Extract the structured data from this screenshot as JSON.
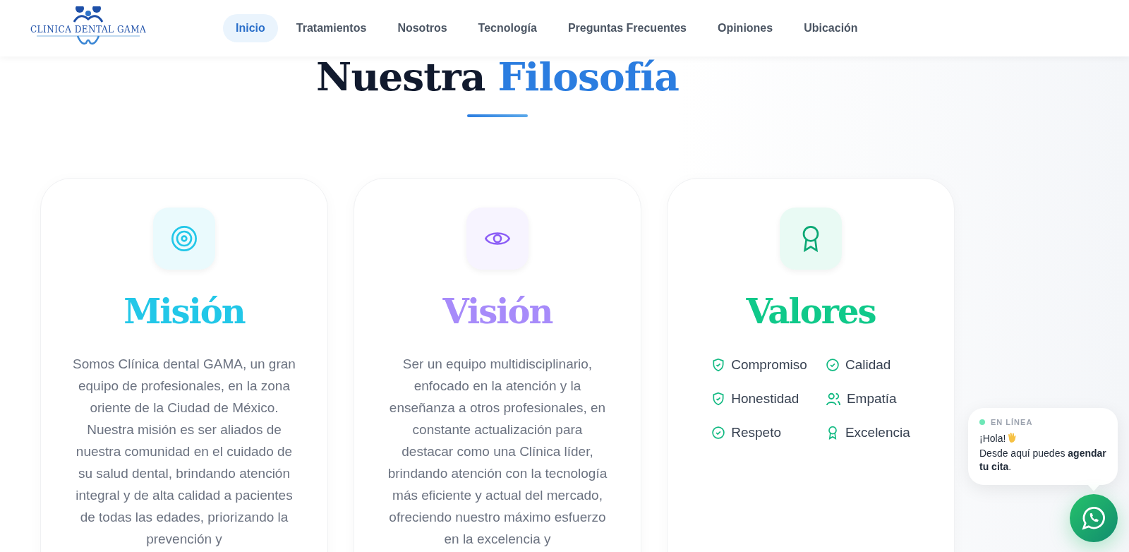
{
  "header": {
    "logo_text": "CLINICA DENTAL GAMA",
    "nav": [
      {
        "label": "Inicio",
        "selected": true
      },
      {
        "label": "Tratamientos",
        "selected": false
      },
      {
        "label": "Nosotros",
        "selected": false
      },
      {
        "label": "Tecnología",
        "selected": false
      },
      {
        "label": "Preguntas Frecuentes",
        "selected": false
      },
      {
        "label": "Opiniones",
        "selected": false
      },
      {
        "label": "Ubicación",
        "selected": false
      }
    ]
  },
  "section": {
    "title_lead": "Nuestra",
    "title_accent": "Filosofía"
  },
  "cards": [
    {
      "kind": "text",
      "color": "#22c7e8",
      "title": "Misión",
      "text": "Somos Clínica dental GAMA, un gran equipo de profesionales, en la zona oriente de la Ciudad de México. Nuestra misión es ser aliados de nuestra comunidad en el cuidado de su salud dental, brindando atención integral y de alta calidad a pacientes de todas las edades, priorizando la prevención y"
    },
    {
      "kind": "text",
      "color": "#a78bfa",
      "title": "Visión",
      "text": "Ser un equipo multidisciplinario, enfocado en la atención y la enseñanza a otros profesionales, en constante actualización para destacar como una Clínica líder, brindando atención con la tecnología más eficiente y actual del mercado, ofreciendo nuestro máximo esfuerzo en la excelencia y"
    },
    {
      "kind": "values",
      "color": "#10c98a",
      "title": "Valores",
      "values": [
        {
          "kind": "shield",
          "label": "Compromiso"
        },
        {
          "kind": "check",
          "label": "Calidad"
        },
        {
          "kind": "shield",
          "label": "Honestidad"
        },
        {
          "kind": "users",
          "label": "Empatía"
        },
        {
          "kind": "check",
          "label": "Respeto"
        },
        {
          "kind": "award",
          "label": "Excelencia"
        }
      ]
    }
  ],
  "chat": {
    "status": "EN LÍNEA",
    "greeting": "¡Hola!",
    "message": "Desde aquí puedes **agendar tu cita**."
  }
}
